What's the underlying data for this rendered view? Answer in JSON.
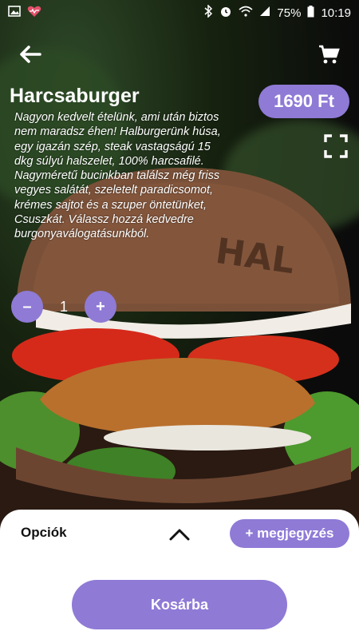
{
  "status_bar": {
    "battery": "75%",
    "time": "10:19",
    "icons": [
      "image-icon",
      "heart-rate-icon",
      "bluetooth-icon",
      "alarm-icon",
      "wifi-icon",
      "signal-icon",
      "battery-icon"
    ]
  },
  "header": {
    "back_icon": "arrow-left-icon",
    "cart_icon": "cart-icon"
  },
  "product": {
    "title": "Harcsaburger",
    "price": "1690 Ft",
    "description": "Nagyon kedvelt ételünk, ami után biztos nem maradsz éhen! Halburgerünk húsa, egy igazán szép, steak vastagságú 15 dkg súlyú halszelet, 100% harcsafilé. Nagyméretű bucinkban találsz még friss vegyes salátát, szeletelt paradicsomot, krémes sajtot és a szuper öntetünket, Csuszkát. Válassz hozzá kedvedre burgonyaválogatásunkból.",
    "quantity": {
      "minus": "–",
      "value": "1",
      "plus": "+"
    }
  },
  "bottom_sheet": {
    "options_label": "Opciók",
    "note_button": "+ megjegyzés",
    "add_to_cart": "Kosárba"
  },
  "colors": {
    "accent": "#8f7ad6",
    "sheet_bg": "#ffffff"
  }
}
